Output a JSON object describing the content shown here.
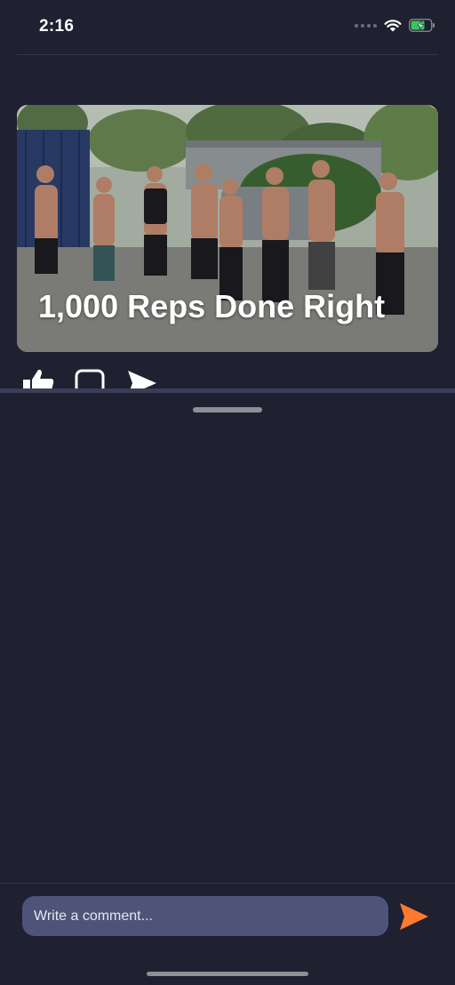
{
  "status_bar": {
    "time": "2:16"
  },
  "post": {
    "title": "1,000 Reps Done Right",
    "image_alt": "Group of men posing in a parking lot",
    "actions": [
      "thumbs-up-icon",
      "comment-box-icon",
      "share-send-icon"
    ]
  },
  "comment_bar": {
    "placeholder": "Write a comment..."
  },
  "colors": {
    "background": "#1f2030",
    "input_fill": "#4e5479",
    "accent": "#ff7a2f"
  }
}
